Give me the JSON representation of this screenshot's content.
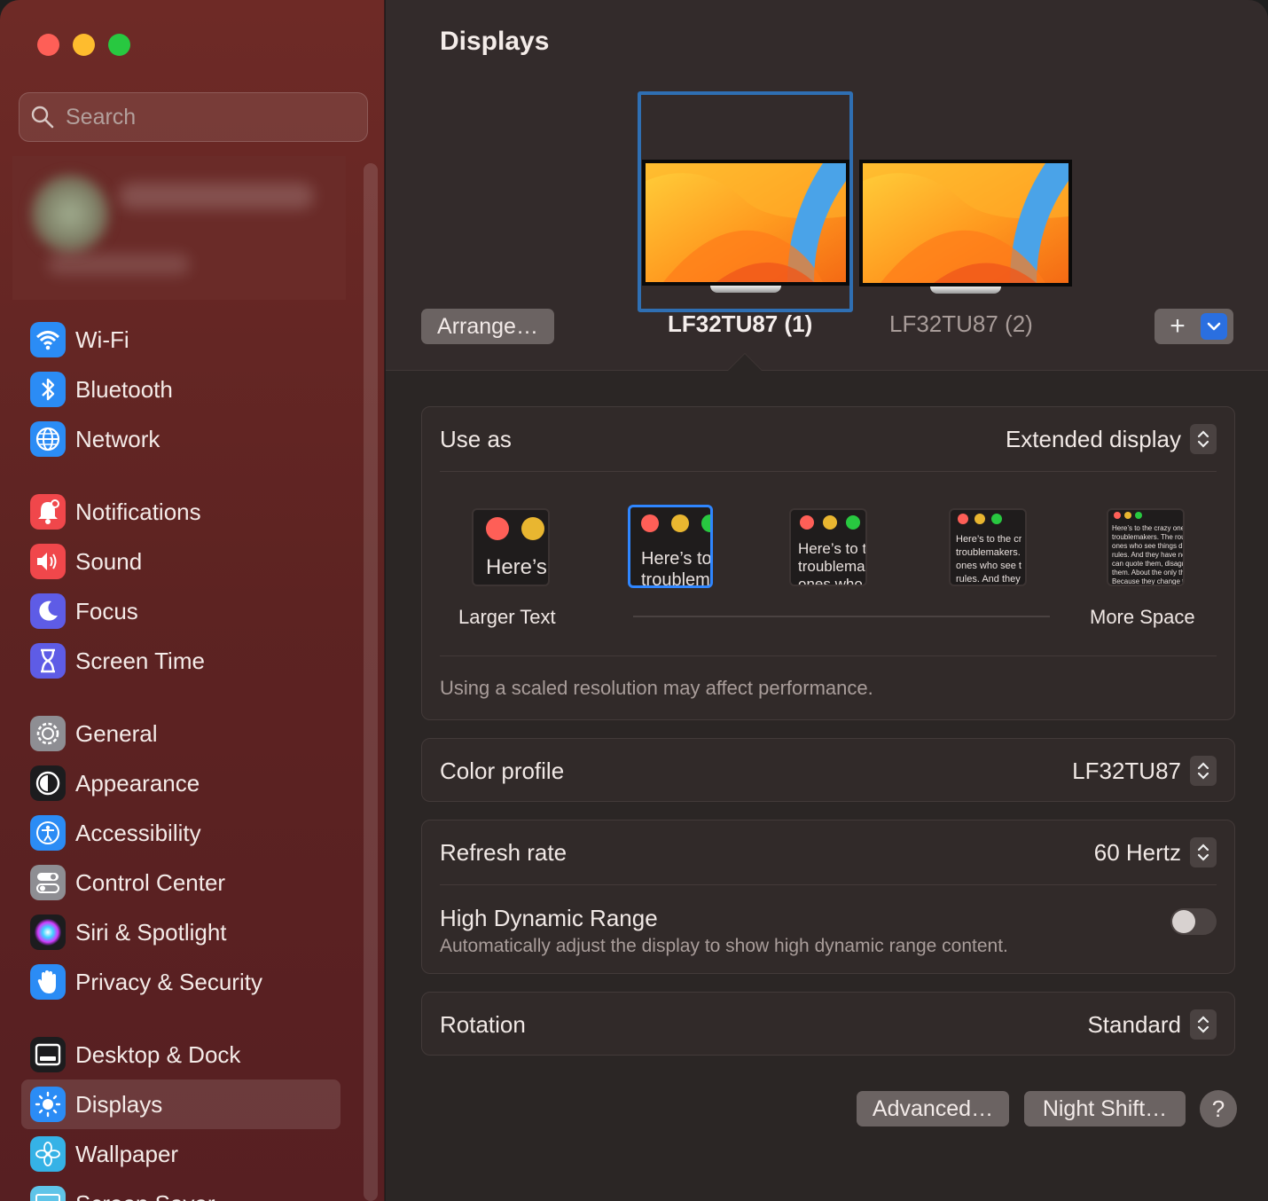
{
  "window": {
    "title": "Displays"
  },
  "search": {
    "placeholder": "Search"
  },
  "sidebar": {
    "groups": [
      [
        {
          "label": "Wi-Fi",
          "icon": "wifi-icon",
          "color": "#2b8cf5"
        },
        {
          "label": "Bluetooth",
          "icon": "bluetooth-icon",
          "color": "#2b8cf5"
        },
        {
          "label": "Network",
          "icon": "globe-icon",
          "color": "#2b8cf5"
        }
      ],
      [
        {
          "label": "Notifications",
          "icon": "bell-icon",
          "color": "#f0474b"
        },
        {
          "label": "Sound",
          "icon": "speaker-icon",
          "color": "#f0474b"
        },
        {
          "label": "Focus",
          "icon": "moon-icon",
          "color": "#5e5ce6"
        },
        {
          "label": "Screen Time",
          "icon": "hourglass-icon",
          "color": "#5e5ce6"
        }
      ],
      [
        {
          "label": "General",
          "icon": "gear-icon",
          "color": "#8e8e93"
        },
        {
          "label": "Appearance",
          "icon": "appearance-icon",
          "color": "#1c1c1e"
        },
        {
          "label": "Accessibility",
          "icon": "accessibility-icon",
          "color": "#2b8cf5"
        },
        {
          "label": "Control Center",
          "icon": "toggles-icon",
          "color": "#8e8e93"
        },
        {
          "label": "Siri & Spotlight",
          "icon": "siri-icon",
          "color": "#1c1c1e"
        },
        {
          "label": "Privacy & Security",
          "icon": "hand-icon",
          "color": "#2b8cf5"
        }
      ],
      [
        {
          "label": "Desktop & Dock",
          "icon": "dock-icon",
          "color": "#1c1c1e"
        },
        {
          "label": "Displays",
          "icon": "sun-icon",
          "color": "#2b8cf5",
          "active": true
        },
        {
          "label": "Wallpaper",
          "icon": "flower-icon",
          "color": "#35b2e6"
        },
        {
          "label": "Screen Saver",
          "icon": "screensaver-icon",
          "color": "#5fc4e8"
        }
      ]
    ]
  },
  "displays": {
    "arrange_label": "Arrange…",
    "monitors": [
      {
        "label": "LF32TU87 (1)",
        "selected": true
      },
      {
        "label": "LF32TU87 (2)",
        "selected": false
      }
    ],
    "add_label": "+"
  },
  "use_as": {
    "label": "Use as",
    "value": "Extended display",
    "resolution_options": [
      {
        "text": "Here’s",
        "selected": false
      },
      {
        "text": "Here’s to\ntroublem",
        "selected": true
      },
      {
        "text": "Here’s to t\ntroublema\nones who",
        "selected": false
      },
      {
        "text": "Here’s to the cr\ntroublemakers.\nones who see t\nrules. And they",
        "selected": false
      },
      {
        "text": "Here’s to the crazy one\ntroublemakers. The rou\nones who see things dif\nrules. And they have no\ncan quote them, disagr\nthem. About the only th\nBecause they change th",
        "selected": false
      }
    ],
    "left_label": "Larger Text",
    "right_label": "More Space",
    "note": "Using a scaled resolution may affect performance."
  },
  "color_profile": {
    "label": "Color profile",
    "value": "LF32TU87"
  },
  "refresh_rate": {
    "label": "Refresh rate",
    "value": "60 Hertz"
  },
  "hdr": {
    "label": "High Dynamic Range",
    "description": "Automatically adjust the display to show high dynamic range content.",
    "enabled": false
  },
  "rotation": {
    "label": "Rotation",
    "value": "Standard"
  },
  "buttons": {
    "advanced": "Advanced…",
    "night_shift": "Night Shift…",
    "help": "?"
  },
  "colors": {
    "accent": "#2f6fb3",
    "sidebar_bg": "#5d2322",
    "main_bg": "#2b2625"
  }
}
